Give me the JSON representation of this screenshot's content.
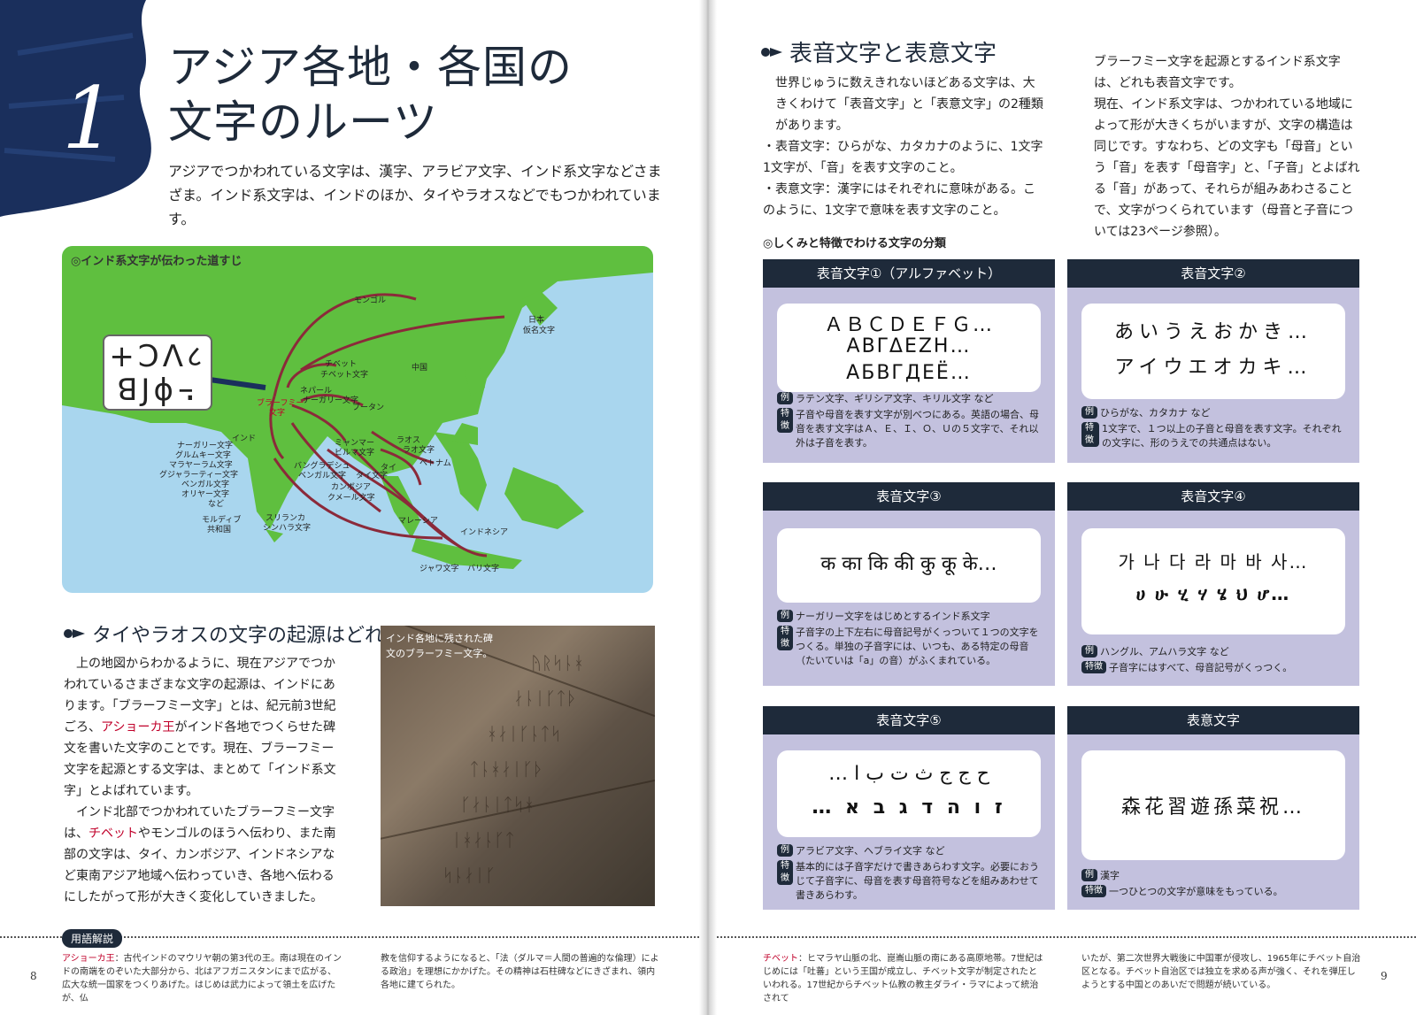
{
  "left": {
    "chapter_number": "1",
    "title_line1": "アジア各地・各国の",
    "title_line2": "文字のルーツ",
    "lead": "アジアでつかわれている文字は、漢字、アラビア文字、インド系文字などさまざま。インド系文字は、インドのほか、タイやラオスなどでもつかわれています。",
    "map": {
      "caption": "◎インド系文字が伝わった道すじ",
      "script_line1": "+ϽΛ८",
      "script_line2": "ꓭJϕ꓾",
      "labels": {
        "mongol": "モンゴル",
        "japan": "日本",
        "japan_script": "仮名文字",
        "tibet": "チベット",
        "tibet_script": "チベット文字",
        "china": "中国",
        "nepal": "ネパール",
        "nepal_script": "ナーガリー文字",
        "brahmi": "ブラーフミー",
        "brahmi_2": "文字",
        "bhutan": "ブータン",
        "india": "インド",
        "nagari": "ナーガリー文字",
        "gurmukhi": "グルムキー文字",
        "malayalam": "マラヤーラム文字",
        "gujarati": "グジャラーティー文字",
        "bengali": "ベンガル文字",
        "oriya": "オリヤー文字",
        "etc": "など",
        "myanmar": "ミャンマー",
        "burmese": "ビルマ文字",
        "laos": "ラオス",
        "lao_script": "ラオ文字",
        "bangladesh": "バングラデシュ",
        "bengali2": "ベンガル文字",
        "thai": "タイ",
        "thai_script": "タイ文字",
        "vietnam": "ベトナム",
        "cambodia": "カンボジア",
        "khmer": "クメール文字",
        "maldives": "モルディブ",
        "maldives_2": "共和国",
        "srilanka": "スリランカ",
        "sinhala": "シンハラ文字",
        "malaysia": "マレーシア",
        "indonesia": "インドネシア",
        "java": "ジャワ文字",
        "bali": "バリ文字"
      }
    },
    "section_heading": "タイやラオスの文字の起源はどれも同じ",
    "body_1": "上の地図からわかるように、現在アジアでつかわれているさまざまな文字の起源は、インドにあります。「ブラーフミー文字」とは、紀元前3世紀ごろ、",
    "body_red_1": "アショーカ王",
    "body_2": "がインド各地でつくらせた碑文を書いた文字のことです。現在、ブラーフミー文字を起源とする文字は、まとめて「インド系文字」とよばれています。",
    "body_3": "インド北部でつかわれていたブラーフミー文字は、",
    "body_red_2": "チベット",
    "body_4": "やモンゴルのほうへ伝わり、また南部の文字は、タイ、カンボジア、インドネシアなど東南アジア地域へ伝わっていき、各地へ伝わるにしたがって形が大きく変化していきました。",
    "photo_caption_1": "インド各地に残された碑",
    "photo_caption_2": "文のブラーフミー文字。",
    "glossary_tag": "用語解説",
    "gloss_term": "アショーカ王",
    "gloss_1": "：古代インドのマウリヤ朝の第3代の王。南は現在のインドの南端をのぞいた大部分から、北はアフガニスタンにまで広がる、広大な統一国家をつくりあげた。はじめは武力によって領土を広げたが、仏",
    "gloss_2": "教を信仰するようになると、「法（ダルマ＝人間の普遍的な倫理）による政治」を理想にかかげた。その精神は石柱碑などにきざまれ、領内各地に建てられた。",
    "page_number": "8"
  },
  "right": {
    "heading": "表音文字と表意文字",
    "col1": "世界じゅうに数えきれないほどある文字は、大きくわけて「表音文字」と「表意文字」の2種類があります。",
    "col1_b1": "・表音文字：ひらがな、カタカナのように、1文字1文字が、「音」を表す文字のこと。",
    "col1_b2": "・表意文字：漢字にはそれぞれに意味がある。このように、1文字で意味を表す文字のこと。",
    "col2_p1": "ブラーフミー文字を起源とするインド系文字は、どれも表音文字です。",
    "col2_p2": "現在、インド系文字は、つかわれている地域によって形が大きくちがいますが、文字の構造は同じです。すなわち、どの文字も「母音」という「音」を表す「母音字」と、「子音」とよばれる「音」があって、それらが組みあわさることで、文字がつくられています（母音と子音については23ページ参照）。",
    "classification_heading": "◎しくみと特徴でわける文字の分類",
    "tag_example": "例",
    "tag_feature": "特徴",
    "cards": [
      {
        "title": "表音文字①（アルファベット）",
        "lines": [
          "ＡＢＣＤＥＦＧ…",
          "ΑΒΓΔΕΖΗ…",
          "АБВГДЕЁ…"
        ],
        "example": "ラテン文字、ギリシア文字、キリル文字 など",
        "feature": "子音や母音を表す文字が別べつにある。英語の場合、母音を表す文字はＡ、Ｅ、Ｉ、Ｏ、Ｕの５文字で、それ以外は子音を表す。"
      },
      {
        "title": "表音文字②",
        "lines": [
          "あいうえおかき…",
          "アイウエオカキ…"
        ],
        "example": "ひらがな、カタカナ など",
        "feature": "1文字で、１つ以上の子音と母音を表す文字。それぞれの文字に、形のうえでの共通点はない。"
      },
      {
        "title": "表音文字③",
        "lines": [
          "क का कि की कु कू के…"
        ],
        "example": "ナーガリー文字をはじめとするインド系文字",
        "feature": "子音字の上下左右に母音記号がくっついて１つの文字をつくる。単独の子音字には、いつも、ある特定の母音（たいていは「a」の音）がふくまれている。"
      },
      {
        "title": "表音文字④",
        "lines": [
          "가 나 다 라 마 바 사…",
          "ሀ ሁ ሂ ሃ ሄ ህ ሆ…"
        ],
        "example": "ハングル、アムハラ文字 など",
        "feature": "子音字にはすべて、母音記号がくっつく。"
      },
      {
        "title": "表音文字⑤",
        "lines": [
          "… ح ج ج ث ت ب ا",
          "… ז ו ה ד ג ב א"
        ],
        "example": "アラビア文字、ヘブライ文字 など",
        "feature": "基本的には子音字だけで書きあらわす文字。必要におうじて子音字に、母音を表す母音符号などを組みあわせて書きあらわす。"
      },
      {
        "title": "表意文字",
        "lines": [
          "森花習遊孫菜祝…"
        ],
        "example": "漢字",
        "feature": "一つひとつの文字が意味をもっている。"
      }
    ],
    "gloss_term": "チベット",
    "gloss_1": "：ヒマラヤ山脈の北、崑崙山脈の南にある高原地帯。7世紀はじめには「吐蕃」という王国が成立し、チベット文字が制定されたといわれる。17世紀からチベット仏教の教主ダライ・ラマによって統治されて",
    "gloss_2": "いたが、第二次世界大戦後に中国軍が侵攻し、1965年にチベット自治区となる。チベット自治区では独立を求める声が強く、それを弾圧しようとする中国とのあいだで問題が続いている。",
    "page_number": "9"
  }
}
